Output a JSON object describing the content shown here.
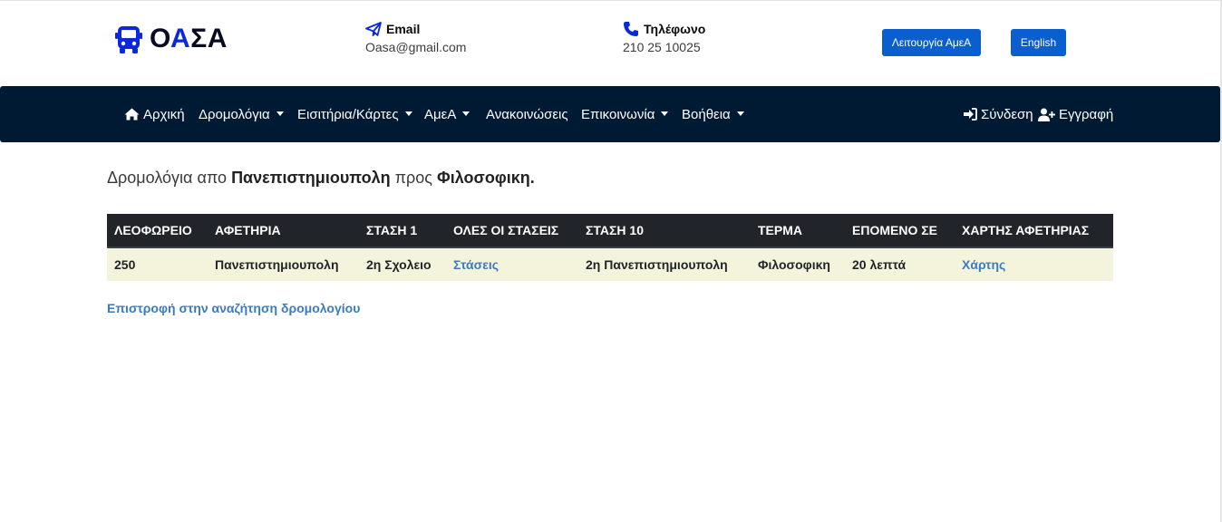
{
  "brand": {
    "logo_left": "Ο",
    "logo_mid": "Α",
    "logo_right": "ΣΑ",
    "bus_icon": "bus-icon"
  },
  "contact": {
    "email_label": "Email",
    "email_value": "Oasa@gmail.com",
    "phone_label": "Τηλέφωνο",
    "phone_value": "210 25 10025"
  },
  "top_buttons": {
    "accessibility": "Λειτουργία ΑμεΑ",
    "language": "English"
  },
  "nav": {
    "home": "Αρχική",
    "routes": "Δρομολόγια",
    "tickets": "Εισιτήρια/Κάρτες",
    "amea": "ΑμεΑ",
    "announcements": "Ανακοινώσεις",
    "contact": "Επικοινωνία",
    "help": "Βοήθεια",
    "login": "Σύνδεση",
    "register": "Εγγραφή"
  },
  "route": {
    "prefix": "Δρομολόγια απο",
    "from": "Πανεπιστημιουπολη",
    "middle": "προς",
    "to": "Φιλοσοφικη."
  },
  "table": {
    "headers": [
      "ΛΕΟΦΩΡΕΙΟ",
      "ΑΦΕΤΗΡΙΑ",
      "ΣΤΑΣΗ 1",
      "ΟΛΕΣ ΟΙ ΣΤΑΣΕΙΣ",
      "ΣΤΑΣΗ 10",
      "ΤΕΡΜΑ",
      "ΕΠΟΜΕΝΟ ΣΕ",
      "ΧΑΡΤΗΣ ΑΦΕΤΗΡΙΑΣ"
    ],
    "rows": [
      [
        "250",
        "Πανεπιστημιουπολη",
        "2η Σχολειο",
        "Στάσεις",
        "2η Πανεπιστημιουπολη",
        "Φιλοσοφικη",
        "20 λεπτά",
        "Χάρτης"
      ]
    ]
  },
  "back_link": "Επιστροφή στην αναζήτηση δρομολογίου",
  "colors": {
    "navbar": "#001a33",
    "accent_button": "#0a5fd0",
    "link": "#3a7bbf",
    "row_bg": "#f4f4dc",
    "table_header": "#212529",
    "logo_blue": "#0a29d9"
  }
}
